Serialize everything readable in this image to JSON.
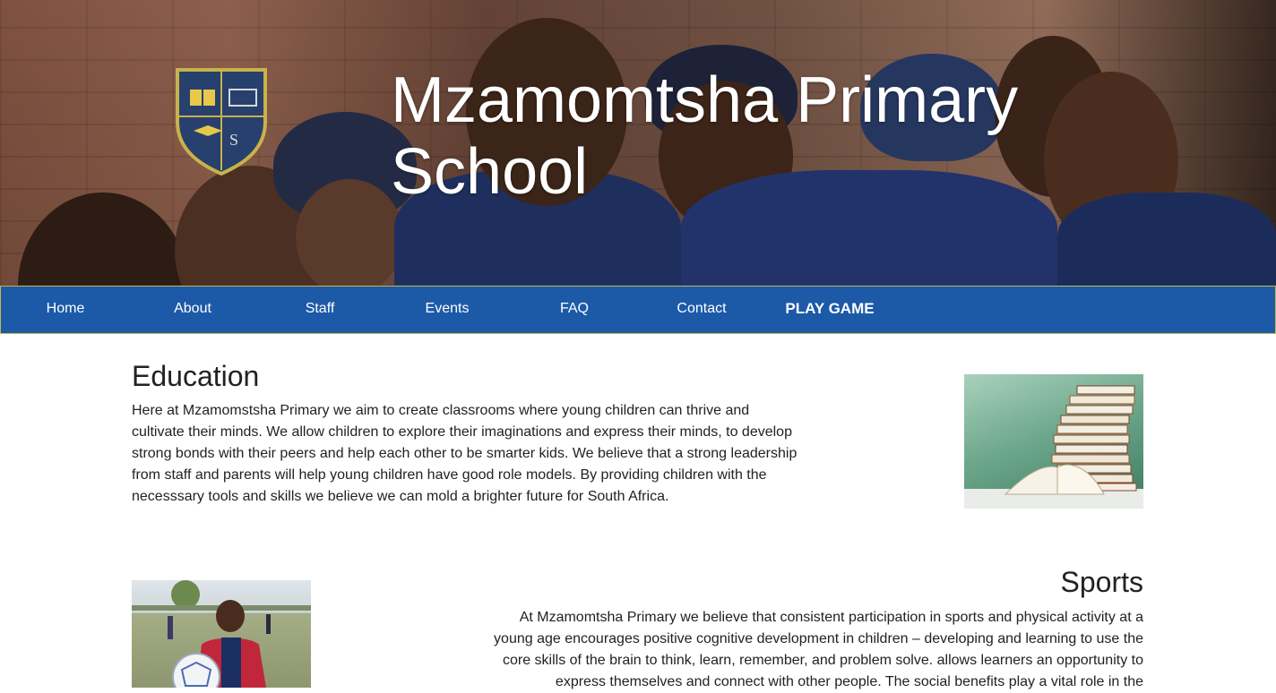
{
  "hero": {
    "title": "Mzamomtsha Primary School",
    "crest_icon": "school-crest-icon"
  },
  "nav": {
    "items": [
      {
        "label": "Home"
      },
      {
        "label": "About"
      },
      {
        "label": "Staff"
      },
      {
        "label": "Events"
      },
      {
        "label": "FAQ"
      },
      {
        "label": "Contact"
      },
      {
        "label": "PLAY GAME"
      }
    ],
    "background": "#1c5aa8",
    "border": "#c9b84a"
  },
  "education": {
    "title": "Education",
    "text": "Here at Mzamomstsha Primary we aim to create classrooms where young children can thrive and cultivate their minds. We allow children to explore their imaginations and express their minds, to develop strong bonds with their peers and help each other to be smarter kids. We believe that a strong leadership from staff and parents will help young children have good role models. By providing children with the necesssary tools and skills we believe we can mold a brighter future for South Africa."
  },
  "sports": {
    "title": "Sports",
    "text": "At Mzamomtsha Primary we believe that consistent participation in sports and physical activity at a young age encourages positive cognitive development in children – developing and learning to use the core skills of the brain to think, learn, remember, and problem solve. allows learners an opportunity to express themselves and connect with other people. The social benefits play a vital role in the"
  }
}
